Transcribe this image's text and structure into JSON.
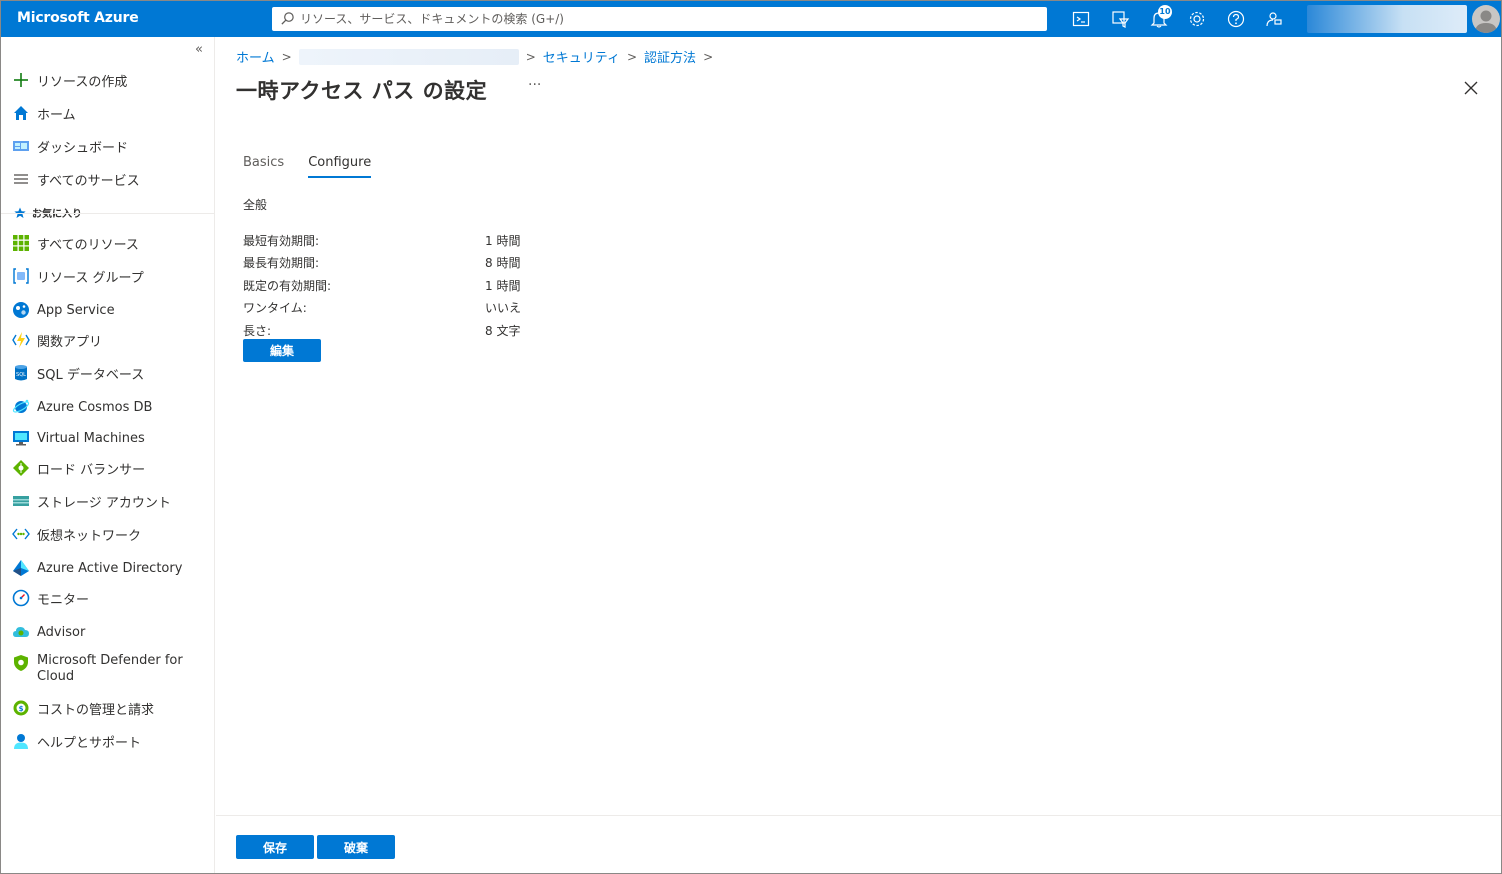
{
  "topbar": {
    "brand": "Microsoft Azure",
    "search_placeholder": "リソース、サービス、ドキュメントの検索 (G+/)",
    "notification_count": "10",
    "icons": [
      "cloud-shell-icon",
      "directory-filter-icon",
      "bell-icon",
      "gear-icon",
      "help-icon",
      "feedback-icon"
    ]
  },
  "sidebar": {
    "collapse_glyph": "«",
    "top_items": [
      {
        "label": "リソースの作成",
        "icon": "plus-icon"
      },
      {
        "label": "ホーム",
        "icon": "home-icon"
      },
      {
        "label": "ダッシュボード",
        "icon": "dashboard-icon"
      },
      {
        "label": "すべてのサービス",
        "icon": "list-icon"
      }
    ],
    "favorites_header": "お気に入り",
    "favorites": [
      {
        "label": "すべてのリソース",
        "icon": "grid-icon"
      },
      {
        "label": "リソース グループ",
        "icon": "resource-group-icon"
      },
      {
        "label": "App Service",
        "icon": "app-service-icon"
      },
      {
        "label": "関数アプリ",
        "icon": "function-icon"
      },
      {
        "label": "SQL データベース",
        "icon": "sql-icon"
      },
      {
        "label": "Azure Cosmos DB",
        "icon": "cosmos-icon"
      },
      {
        "label": "Virtual Machines",
        "icon": "vm-icon"
      },
      {
        "label": "ロード バランサー",
        "icon": "load-balancer-icon"
      },
      {
        "label": "ストレージ アカウント",
        "icon": "storage-icon"
      },
      {
        "label": "仮想ネットワーク",
        "icon": "vnet-icon"
      },
      {
        "label": "Azure Active Directory",
        "icon": "aad-icon"
      },
      {
        "label": "モニター",
        "icon": "monitor-icon"
      },
      {
        "label": "Advisor",
        "icon": "advisor-icon"
      },
      {
        "label": "Microsoft Defender for Cloud",
        "icon": "defender-icon"
      },
      {
        "label": "コストの管理と請求",
        "icon": "cost-icon"
      },
      {
        "label": "ヘルプとサポート",
        "icon": "help-support-icon"
      }
    ]
  },
  "breadcrumb": {
    "home": "ホーム",
    "security": "セキュリティ",
    "auth_methods": "認証方法"
  },
  "page": {
    "title": "一時アクセス パス の設定",
    "more": "···"
  },
  "tabs": [
    {
      "label": "Basics",
      "active": false
    },
    {
      "label": "Configure",
      "active": true
    }
  ],
  "config": {
    "section_title": "全般",
    "rows": [
      {
        "key": "最短有効期間:",
        "value": "1 時間"
      },
      {
        "key": "最長有効期間:",
        "value": "8 時間"
      },
      {
        "key": "既定の有効期間:",
        "value": "1 時間"
      },
      {
        "key": "ワンタイム:",
        "value": "いいえ"
      },
      {
        "key": "長さ:",
        "value": "8 文字"
      }
    ],
    "edit_label": "編集"
  },
  "footer": {
    "save_label": "保存",
    "discard_label": "破棄"
  },
  "colors": {
    "accent": "#0078d4"
  }
}
